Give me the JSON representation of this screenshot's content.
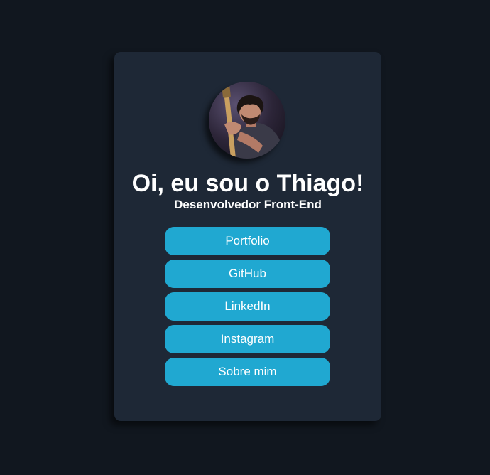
{
  "profile": {
    "heading": "Oi, eu sou o Thiago!",
    "role": "Desenvolvedor Front-End",
    "avatar_icon": "profile-photo-guitar"
  },
  "links": [
    {
      "label": "Portfolio"
    },
    {
      "label": "GitHub"
    },
    {
      "label": "LinkedIn"
    },
    {
      "label": "Instagram"
    },
    {
      "label": "Sobre mim"
    }
  ],
  "colors": {
    "page_background": "#11171f",
    "card_background": "#1e2836",
    "button_background": "#20a8d1",
    "text": "#ffffff"
  }
}
